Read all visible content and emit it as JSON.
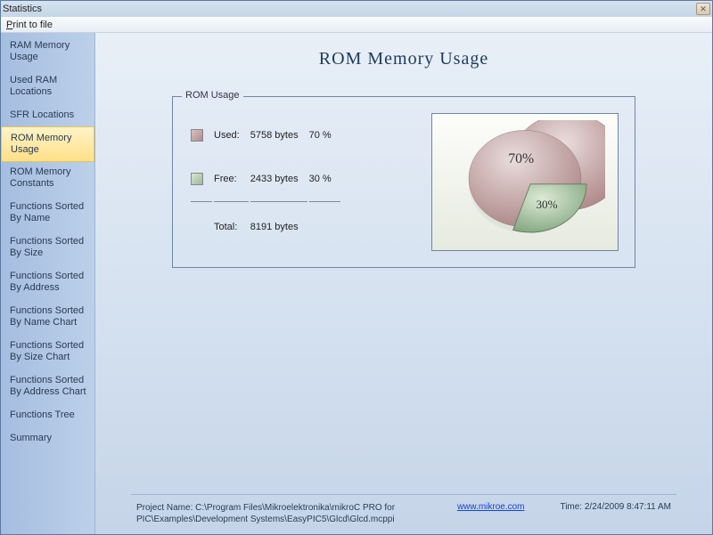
{
  "window": {
    "title": "Statistics"
  },
  "menu": {
    "print_label": "Print to file",
    "print_underline_char": "P"
  },
  "sidebar": {
    "items": [
      {
        "label": "RAM Memory Usage"
      },
      {
        "label": "Used RAM Locations"
      },
      {
        "label": "SFR Locations"
      },
      {
        "label": "ROM Memory Usage"
      },
      {
        "label": "ROM Memory Constants"
      },
      {
        "label": "Functions Sorted By  Name"
      },
      {
        "label": "Functions Sorted By Size"
      },
      {
        "label": "Functions Sorted By Address"
      },
      {
        "label": "Functions Sorted By Name Chart"
      },
      {
        "label": "Functions Sorted By Size Chart"
      },
      {
        "label": "Functions Sorted By Address Chart"
      },
      {
        "label": "Functions Tree"
      },
      {
        "label": "Summary"
      }
    ],
    "selected_index": 3
  },
  "page": {
    "title": "ROM Memory  Usage"
  },
  "groupbox": {
    "legend": "ROM Usage"
  },
  "table": {
    "used_label": "Used:",
    "used_bytes": "5758 bytes",
    "used_pct": "70 %",
    "free_label": "Free:",
    "free_bytes": "2433 bytes",
    "free_pct": "30 %",
    "total_label": "Total:",
    "total_bytes": "8191 bytes"
  },
  "chart_data": {
    "type": "pie",
    "title": "ROM Usage",
    "series": [
      {
        "name": "Used",
        "value": 70,
        "label": "70%",
        "color": "#b99696"
      },
      {
        "name": "Free",
        "value": 30,
        "label": "30%",
        "color": "#97b393"
      }
    ]
  },
  "footer": {
    "project_label": "Project Name: C:\\Program Files\\Mikroelektronika\\mikroC PRO for PIC\\Examples\\Development Systems\\EasyPIC5\\Glcd\\Glcd.mcppi",
    "link_text": "www.mikroe.com",
    "time_label": "Time: 2/24/2009 8:47:11 AM"
  }
}
